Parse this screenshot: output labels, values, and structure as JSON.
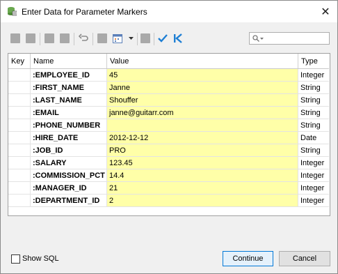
{
  "window": {
    "title": "Enter Data for Parameter Markers",
    "close_glyph": "✕"
  },
  "toolbar": {
    "search_placeholder": ""
  },
  "grid": {
    "columns": [
      "Key",
      "Name",
      "Value",
      "Type"
    ],
    "rows": [
      {
        "name": ":EMPLOYEE_ID",
        "value": "45",
        "type": "Integer"
      },
      {
        "name": ":FIRST_NAME",
        "value": "Janne",
        "type": "String"
      },
      {
        "name": ":LAST_NAME",
        "value": "Shouffer",
        "type": "String"
      },
      {
        "name": ":EMAIL",
        "value": "janne@guitarr.com",
        "type": "String"
      },
      {
        "name": ":PHONE_NUMBER",
        "value": "",
        "type": "String"
      },
      {
        "name": ":HIRE_DATE",
        "value": "2012-12-12",
        "type": "Date"
      },
      {
        "name": ":JOB_ID",
        "value": "PRO",
        "type": "String"
      },
      {
        "name": ":SALARY",
        "value": "123.45",
        "type": "Integer"
      },
      {
        "name": ":COMMISSION_PCT",
        "value": "14.4",
        "type": "Integer"
      },
      {
        "name": ":MANAGER_ID",
        "value": "21",
        "type": "Integer"
      },
      {
        "name": ":DEPARTMENT_ID",
        "value": "2",
        "type": "Integer"
      }
    ]
  },
  "footer": {
    "show_sql_label": "Show SQL",
    "show_sql_checked": false,
    "continue_label": "Continue",
    "cancel_label": "Cancel"
  },
  "colors": {
    "value_cell_bg": "#ffffa8",
    "accent": "#0078d7",
    "check_icon": "#1e7fd4"
  }
}
